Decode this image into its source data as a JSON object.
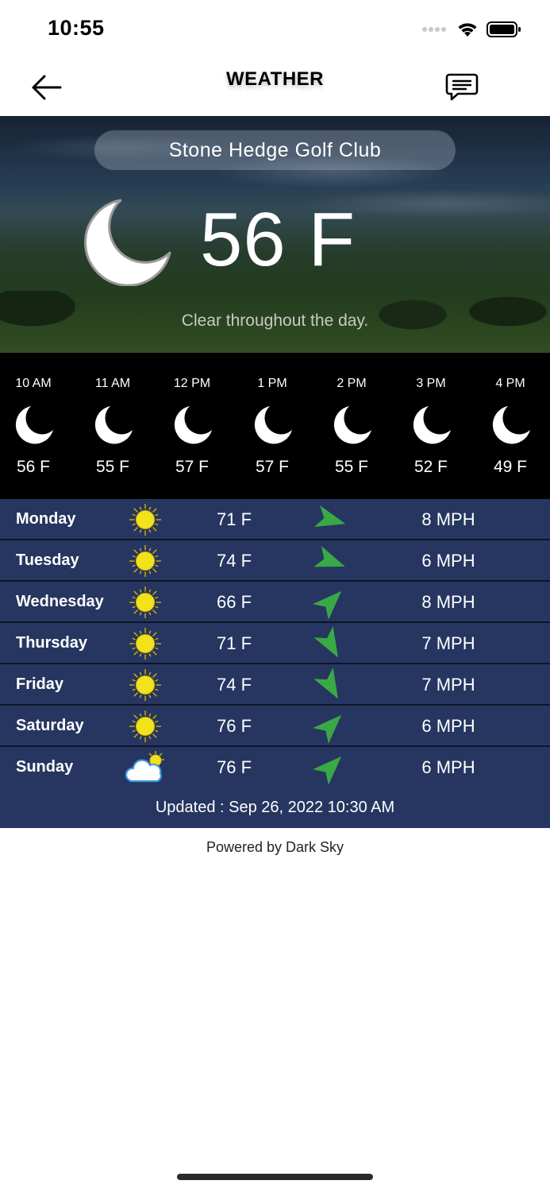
{
  "status_bar": {
    "time": "10:55"
  },
  "nav": {
    "title": "WEATHER"
  },
  "hero": {
    "location": "Stone Hedge Golf Club",
    "temperature": "56 F",
    "summary": "Clear throughout the day.",
    "icon": "moon-icon"
  },
  "hourly": [
    {
      "time": "10 AM",
      "temp": "56 F",
      "icon": "moon-icon"
    },
    {
      "time": "11 AM",
      "temp": "55 F",
      "icon": "moon-icon"
    },
    {
      "time": "12 PM",
      "temp": "57 F",
      "icon": "moon-icon"
    },
    {
      "time": "1 PM",
      "temp": "57 F",
      "icon": "moon-icon"
    },
    {
      "time": "2 PM",
      "temp": "55 F",
      "icon": "moon-icon"
    },
    {
      "time": "3 PM",
      "temp": "52 F",
      "icon": "moon-icon"
    },
    {
      "time": "4 PM",
      "temp": "49 F",
      "icon": "moon-icon"
    }
  ],
  "daily": [
    {
      "day": "Monday",
      "icon": "sun-icon",
      "temp": "71 F",
      "wind": "8 MPH",
      "wind_arrow_deg": 105
    },
    {
      "day": "Tuesday",
      "icon": "sun-icon",
      "temp": "74 F",
      "wind": "6 MPH",
      "wind_arrow_deg": 110
    },
    {
      "day": "Wednesday",
      "icon": "sun-icon",
      "temp": "66 F",
      "wind": "8 MPH",
      "wind_arrow_deg": 45
    },
    {
      "day": "Thursday",
      "icon": "sun-icon",
      "temp": "71 F",
      "wind": "7 MPH",
      "wind_arrow_deg": 150
    },
    {
      "day": "Friday",
      "icon": "sun-icon",
      "temp": "74 F",
      "wind": "7 MPH",
      "wind_arrow_deg": 150
    },
    {
      "day": "Saturday",
      "icon": "sun-icon",
      "temp": "76 F",
      "wind": "6 MPH",
      "wind_arrow_deg": 45
    },
    {
      "day": "Sunday",
      "icon": "partly-cloudy-icon",
      "temp": "76 F",
      "wind": "6 MPH",
      "wind_arrow_deg": 45
    }
  ],
  "footer": {
    "updated": "Updated : Sep 26, 2022 10:30 AM",
    "powered_by": "Powered by Dark Sky"
  },
  "colors": {
    "daily_row_bg": "#263660",
    "hourly_bg": "#000000",
    "arrow_green": "#3aa845",
    "sun_yellow": "#f2e21b"
  }
}
